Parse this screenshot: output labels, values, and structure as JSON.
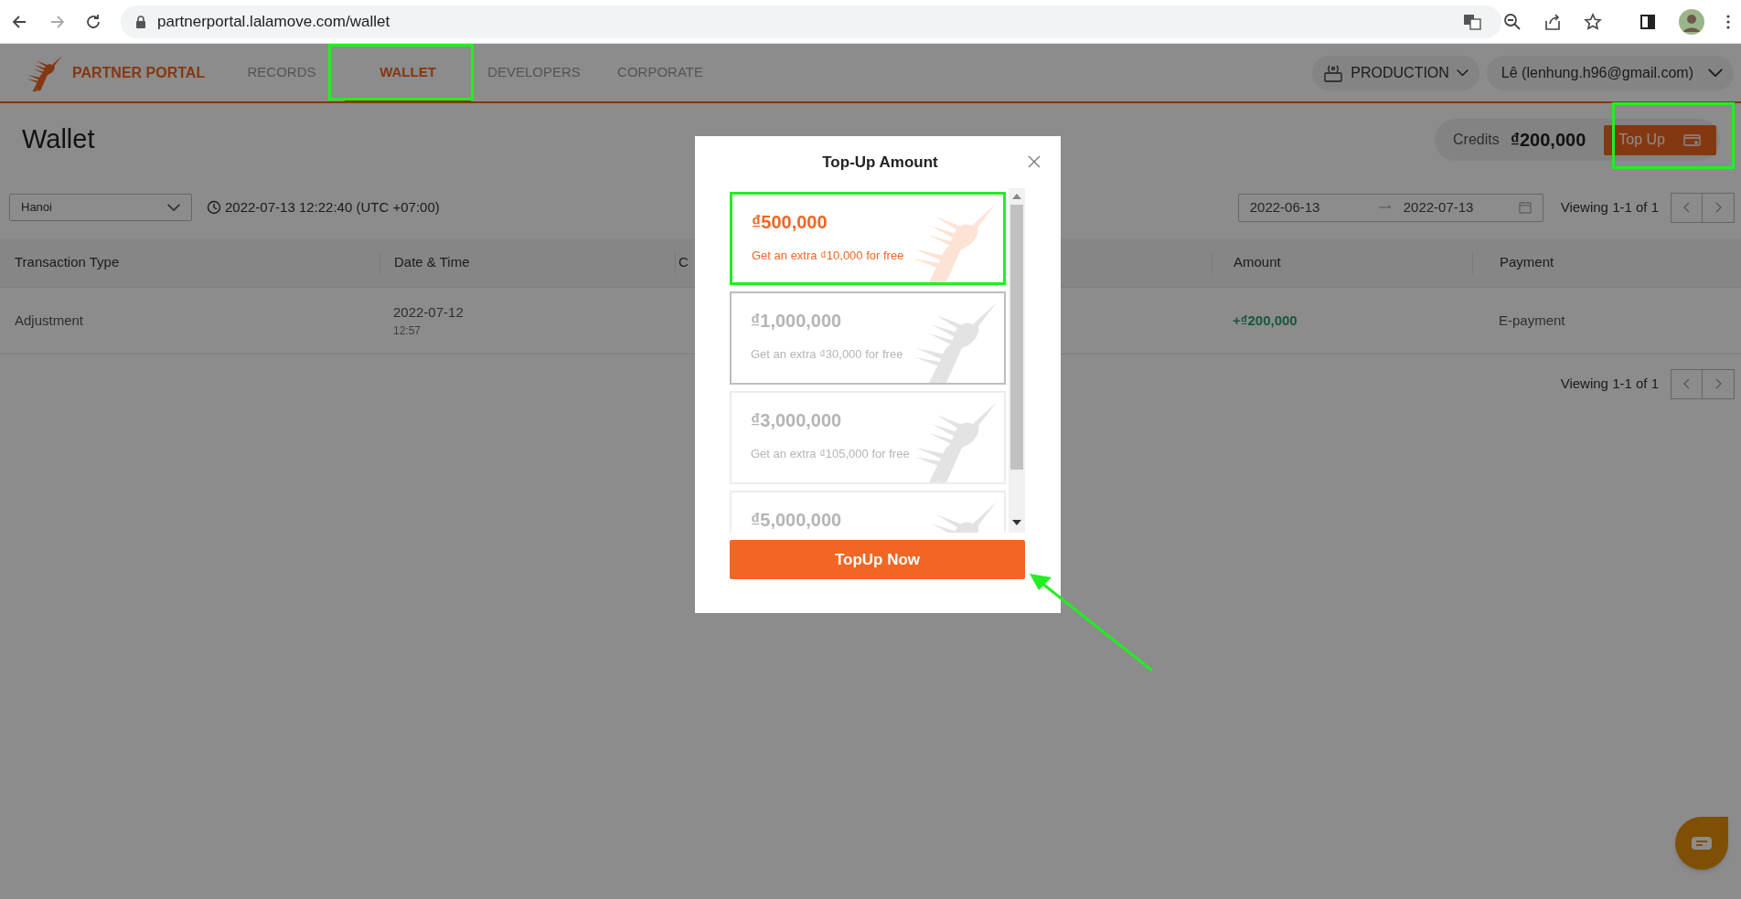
{
  "browser": {
    "url": "partnerportal.lalamove.com/wallet"
  },
  "nav": {
    "brand": "PARTNER PORTAL",
    "items": [
      {
        "label": "RECORDS",
        "selected": false
      },
      {
        "label": "WALLET",
        "selected": true
      },
      {
        "label": "DEVELOPERS",
        "selected": false
      },
      {
        "label": "CORPORATE",
        "selected": false
      }
    ],
    "environment": "PRODUCTION",
    "account": "Lê (lenhung.h96@gmail.com)"
  },
  "page": {
    "title": "Wallet",
    "credits_label": "Credits",
    "credits": "₫200,000",
    "top_up": "Top Up",
    "city": "Hanoi",
    "time": "2022-07-13 12:22:40 (UTC +07:00)",
    "date_from": "2022-06-13",
    "date_to": "2022-07-13",
    "viewing": "Viewing 1-1 of 1"
  },
  "table": {
    "columns": [
      "Transaction Type",
      "Date & Time",
      "C",
      "Amount",
      "Payment"
    ],
    "rows": [
      {
        "type": "Adjustment",
        "date": "2022-07-12",
        "time": "12:57",
        "amount": "+₫200,000",
        "payment": "E-payment"
      }
    ]
  },
  "pagination_bottom": {
    "viewing": "Viewing 1-1 of 1"
  },
  "modal": {
    "title": "Top-Up Amount",
    "options": [
      {
        "amount": "₫500,000",
        "bonus": "Get an extra ₫10,000 for free",
        "selected": true,
        "hovered": false
      },
      {
        "amount": "₫1,000,000",
        "bonus": "Get an extra ₫30,000 for free",
        "selected": false,
        "hovered": true
      },
      {
        "amount": "₫3,000,000",
        "bonus": "Get an extra ₫105,000 for free",
        "selected": false,
        "hovered": false
      },
      {
        "amount": "₫5,000,000",
        "selected": false,
        "hovered": false
      }
    ],
    "button": "TopUp Now"
  }
}
